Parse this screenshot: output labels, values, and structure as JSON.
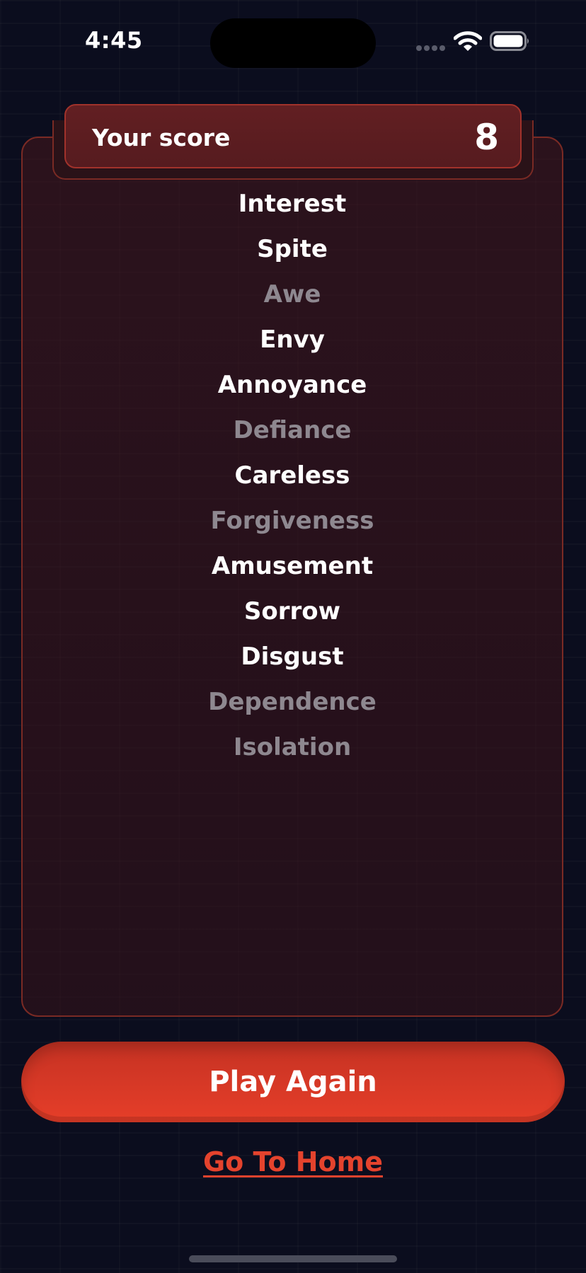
{
  "status_bar": {
    "time": "4:45",
    "icons": [
      "cellular-signal-icon",
      "wifi-icon",
      "battery-icon"
    ]
  },
  "score": {
    "label": "Your score",
    "value": "8"
  },
  "words": [
    {
      "text": "Interest",
      "state": "found"
    },
    {
      "text": "Spite",
      "state": "found"
    },
    {
      "text": "Awe",
      "state": "missed"
    },
    {
      "text": "Envy",
      "state": "found"
    },
    {
      "text": "Annoyance",
      "state": "found"
    },
    {
      "text": "Defiance",
      "state": "missed"
    },
    {
      "text": "Careless",
      "state": "found"
    },
    {
      "text": "Forgiveness",
      "state": "missed"
    },
    {
      "text": "Amusement",
      "state": "found"
    },
    {
      "text": "Sorrow",
      "state": "found"
    },
    {
      "text": "Disgust",
      "state": "found"
    },
    {
      "text": "Dependence",
      "state": "missed"
    },
    {
      "text": "Isolation",
      "state": "missed"
    }
  ],
  "actions": {
    "play_again": "Play Again",
    "go_home": "Go To Home"
  },
  "colors": {
    "background": "#0b0d1e",
    "accent": "#e4432d",
    "panel_border": "#7a2a24",
    "found_text": "#ffffff",
    "missed_text": "#8e8890"
  }
}
